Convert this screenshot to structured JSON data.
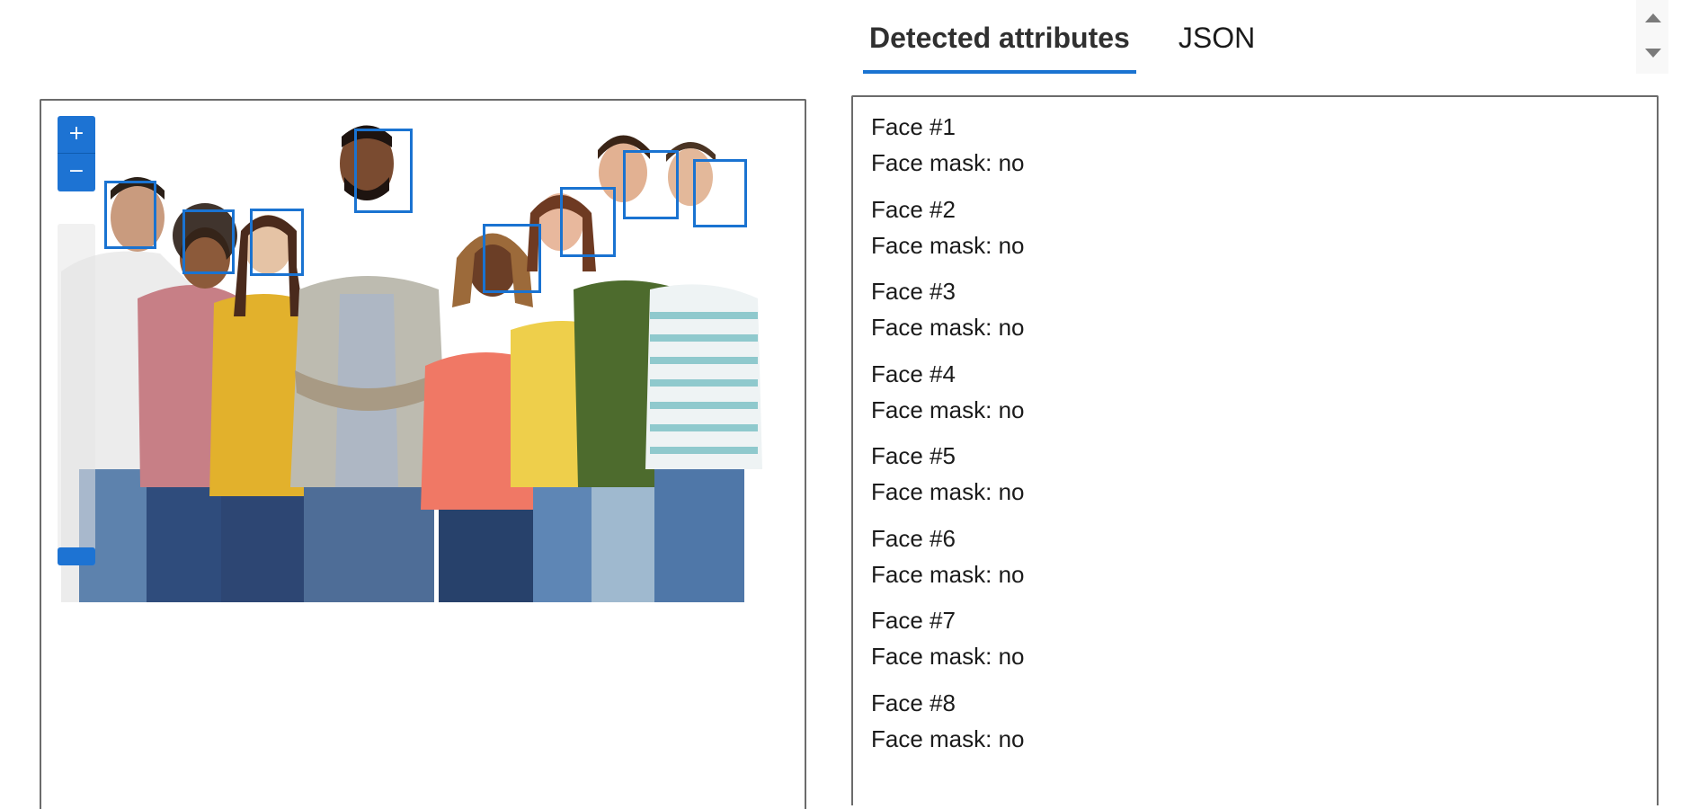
{
  "tabs": [
    {
      "label": "Detected attributes",
      "active": true
    },
    {
      "label": "JSON",
      "active": false
    }
  ],
  "viewer": {
    "zoom_in_label": "+",
    "zoom_out_label": "−",
    "face_box_color": "#1a73d1"
  },
  "faces": [
    {
      "title": "Face #1",
      "mask": "Face mask: no"
    },
    {
      "title": "Face #2",
      "mask": "Face mask: no"
    },
    {
      "title": "Face #3",
      "mask": "Face mask: no"
    },
    {
      "title": "Face #4",
      "mask": "Face mask: no"
    },
    {
      "title": "Face #5",
      "mask": "Face mask: no"
    },
    {
      "title": "Face #6",
      "mask": "Face mask: no"
    },
    {
      "title": "Face #7",
      "mask": "Face mask: no"
    },
    {
      "title": "Face #8",
      "mask": "Face mask: no"
    }
  ],
  "colors": {
    "accent": "#1a73d1",
    "border": "#6b6b6b"
  }
}
